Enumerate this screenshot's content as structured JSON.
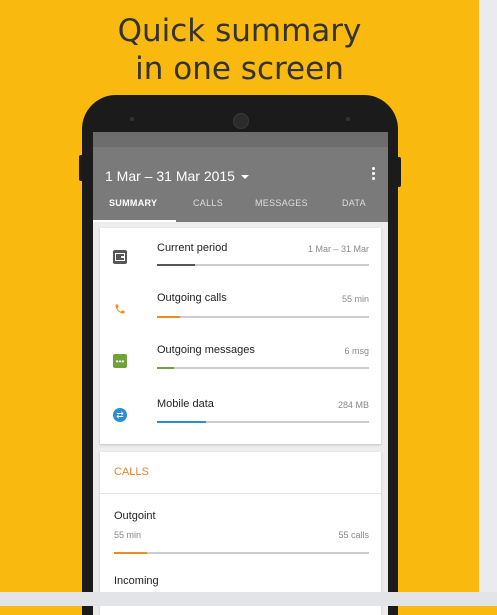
{
  "headline": {
    "line1": "Quick summary",
    "line2": "in one screen"
  },
  "app": {
    "date_range": "1 Mar – 31 Mar 2015",
    "tabs": [
      {
        "label": "SUMMARY",
        "active": true
      },
      {
        "label": "CALLS",
        "active": false
      },
      {
        "label": "MESSAGES",
        "active": false
      },
      {
        "label": "DATA",
        "active": false
      }
    ]
  },
  "summary": {
    "items": [
      {
        "title": "Current period",
        "value": "1 Mar – 31 Mar",
        "icon": "wallet-icon",
        "color": "#555555",
        "progress": 0.18
      },
      {
        "title": "Outgoing calls",
        "value": "55 min",
        "icon": "phone-icon",
        "color": "#f28b1e",
        "progress": 0.11
      },
      {
        "title": "Outgoing messages",
        "value": "6 msg",
        "icon": "message-icon",
        "color": "#6fa33a",
        "progress": 0.08
      },
      {
        "title": "Mobile data",
        "value": "284 MB",
        "icon": "globe-icon",
        "color": "#2a8fd0",
        "progress": 0.23
      }
    ]
  },
  "calls": {
    "header": "CALLS",
    "outgoing": {
      "title": "Outgoint",
      "minutes": "55 min",
      "calls": "55 calls",
      "progress": 0.13
    },
    "incoming": {
      "title": "Incoming"
    }
  },
  "colors": {
    "background": "#f9b90e",
    "accent": "#e8832b",
    "appbar": "#7a7a7a"
  }
}
